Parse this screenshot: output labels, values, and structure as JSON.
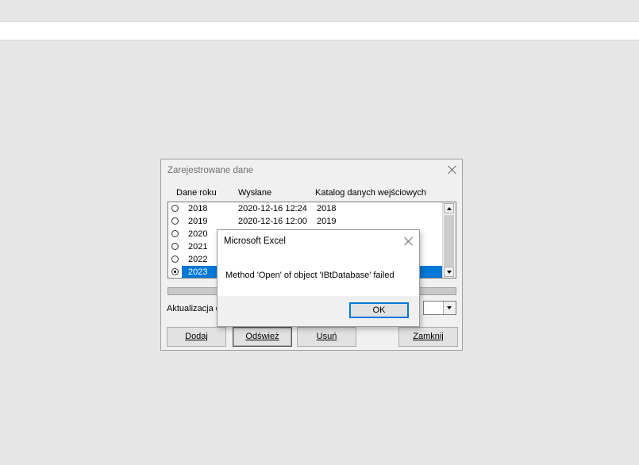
{
  "dialog": {
    "title": "Zarejestrowane dane",
    "columns": {
      "year": "Dane roku",
      "sent": "Wysłane",
      "catalog": "Katalog danych wejściowych"
    },
    "rows": [
      {
        "year": "2018",
        "sent": "2020-12-16 12:24",
        "catalog": "2018",
        "selected": false
      },
      {
        "year": "2019",
        "sent": "2020-12-16 12:00",
        "catalog": "2019",
        "selected": false
      },
      {
        "year": "2020",
        "sent": "",
        "catalog": "",
        "selected": false
      },
      {
        "year": "2021",
        "sent": "",
        "catalog": "",
        "selected": false
      },
      {
        "year": "2022",
        "sent": "",
        "catalog": "",
        "selected": false
      },
      {
        "year": "2023",
        "sent": "",
        "catalog": "",
        "selected": true
      }
    ],
    "update_label": "Aktualizacja d",
    "buttons": {
      "add": "Dodaj",
      "refresh": "Odśwież",
      "delete": "Usuń",
      "close": "Zamknij"
    },
    "selection_color": "#0078d7"
  },
  "msgbox": {
    "title": "Microsoft Excel",
    "message": "Method 'Open' of object 'IBtDatabase' failed",
    "ok_label": "OK"
  }
}
